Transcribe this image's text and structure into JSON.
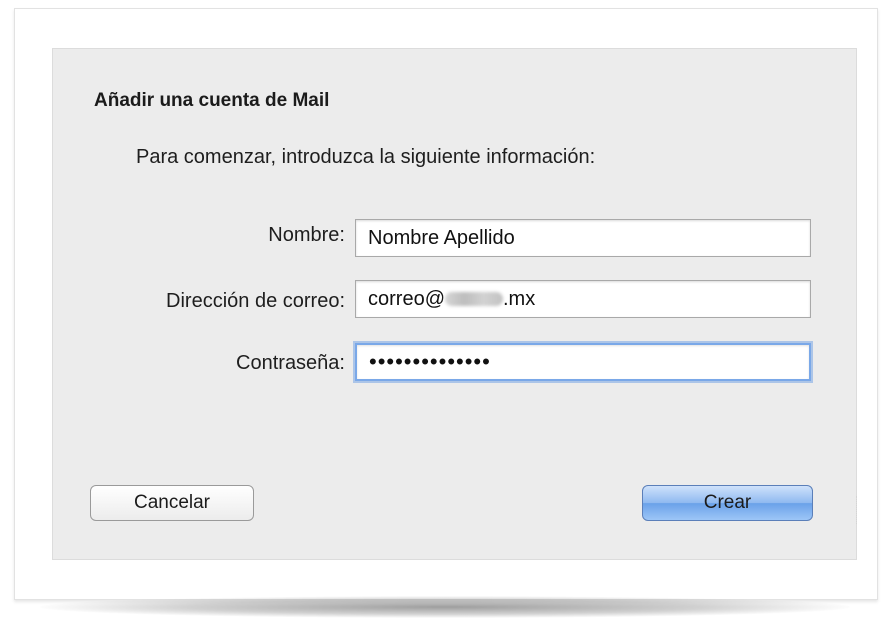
{
  "dialog": {
    "title": "Añadir una cuenta de Mail",
    "subtitle": "Para comenzar, introduzca la siguiente información:",
    "fields": {
      "name": {
        "label": "Nombre:",
        "value": "Nombre Apellido"
      },
      "email": {
        "label": "Dirección de correo:",
        "value_prefix": "correo@",
        "value_suffix": ".mx"
      },
      "password": {
        "label": "Contraseña:",
        "value": "••••••••••••••"
      }
    },
    "buttons": {
      "cancel": "Cancelar",
      "create": "Crear"
    }
  },
  "colors": {
    "sheet_background": "#ececec",
    "focus_ring": "#7aa8e8",
    "default_button": "#6aa1e9"
  }
}
